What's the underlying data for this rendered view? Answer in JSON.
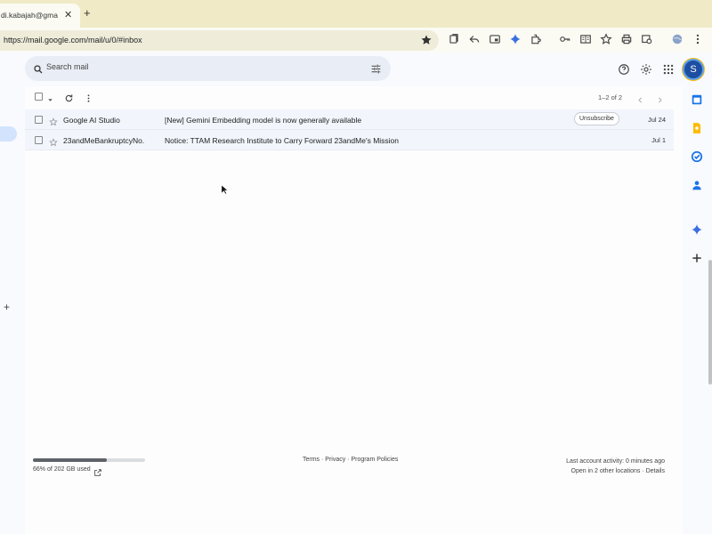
{
  "browser": {
    "tab_title": "di.kabajah@gmail.com",
    "tab_close": "✕",
    "new_tab": "+",
    "url": "https://mail.google.com/mail/u/0/#inbox",
    "toolbar_icons": [
      "bookmark-star-icon",
      "tab-search-icon",
      "reply-icon",
      "picture-in-picture-icon",
      "gemini-sparkle-icon",
      "extensions-icon",
      "password-key-icon",
      "reading-mode-icon",
      "bookmarks-icon",
      "print-icon",
      "translate-icon",
      "profile-globe-icon",
      "more-vert-icon"
    ]
  },
  "gmail": {
    "search_placeholder": "Search mail",
    "avatar_letter": "S",
    "pager": "1–2 of 2",
    "emails": [
      {
        "sender": "Google AI Studio",
        "subject": "[New] Gemini Embedding model is now generally available",
        "unsubscribe": "Unsubscribe",
        "date": "Jul 24"
      },
      {
        "sender": "23andMeBankruptcyNo.",
        "subject": "Notice: TTAM Research Institute to Carry Forward 23andMe's Mission",
        "date": "Jul 1"
      }
    ],
    "storage_text": "66% of 202 GB used",
    "storage_fraction": 0.66,
    "footer_links": "Terms · Privacy · Program Policies",
    "activity_line1": "Last account activity: 0 minutes ago",
    "activity_line2": "Open in 2 other locations · Details",
    "nav_plus": "+"
  },
  "colors": {
    "tabstrip": "#f0ebc6",
    "accent_blue": "#1a73e8",
    "row_bg": "#f2f6fc"
  }
}
